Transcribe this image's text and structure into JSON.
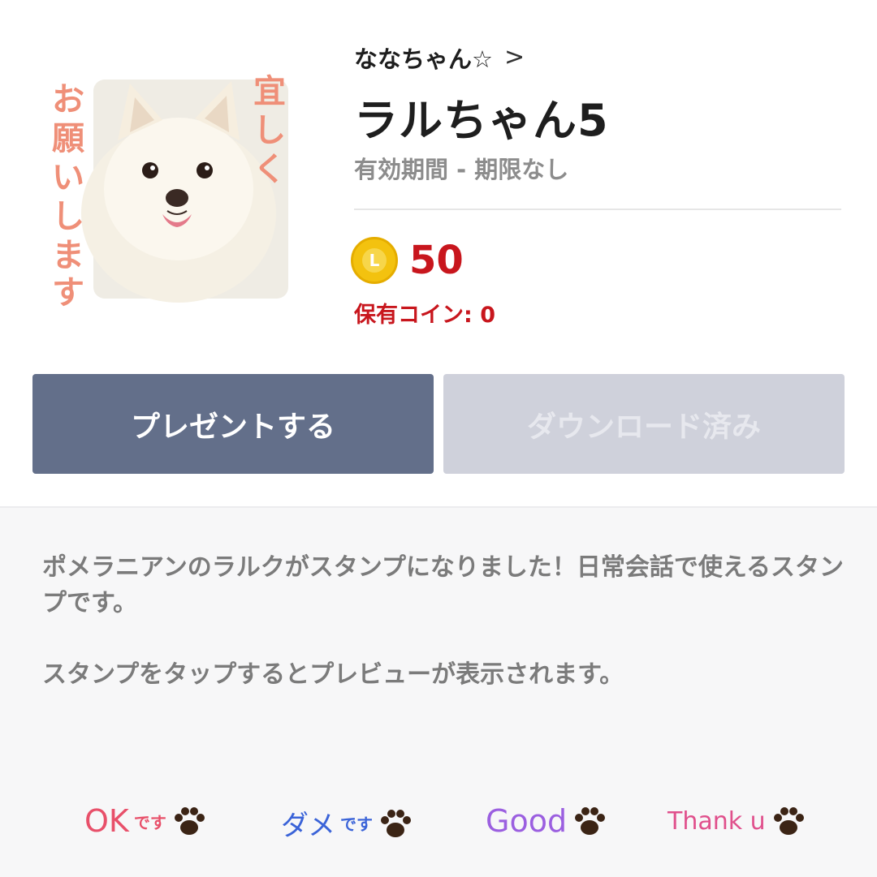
{
  "product": {
    "author": "ななちゃん☆",
    "author_chevron": ">",
    "title": "ラルちゃん5",
    "validity": "有効期間 - 期限なし",
    "hero_caption_right": "宜しく",
    "hero_caption_left": "お願いします"
  },
  "price": {
    "coin_letter": "L",
    "amount": "50",
    "owned_coins": "保有コイン: 0"
  },
  "buttons": {
    "present_label": "プレゼントする",
    "download_label": "ダウンロード済み"
  },
  "description": {
    "line1": "ポメラニアンのラルクがスタンプになりました！日常会話で使えるスタンプです。",
    "line2": "スタンプをタップするとプレビューが表示されます。"
  },
  "stickers": [
    {
      "label_main": "OK",
      "label_sub": "です",
      "color": "#e8506a"
    },
    {
      "label_main": "ダメ",
      "label_sub": "です",
      "color": "#3a63d8"
    },
    {
      "label_main": "Good",
      "label_sub": "",
      "color": "#9b5fe0"
    },
    {
      "label_main": "Thank u",
      "label_sub": "",
      "color": "#e0508c"
    }
  ],
  "colors": {
    "button_primary": "#636f8a",
    "button_disabled": "#cfd1db",
    "price_red": "#c8161d",
    "coin_gold": "#f3c20f",
    "caption_salmon": "#ef8f78"
  }
}
